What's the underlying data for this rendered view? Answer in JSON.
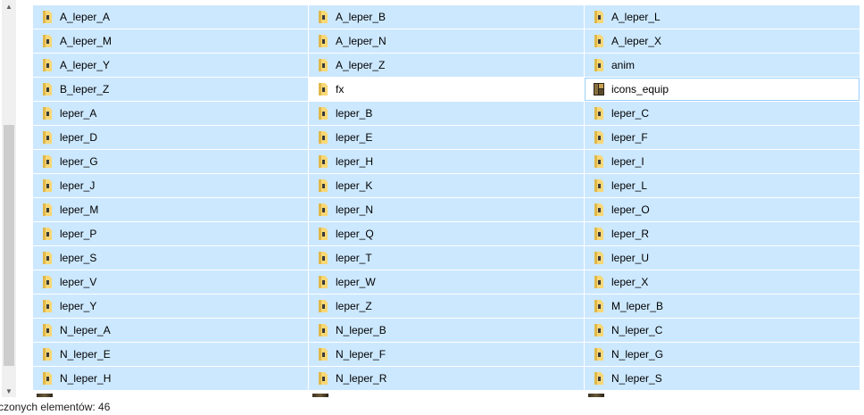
{
  "colors": {
    "selection_bg": "#cce8ff",
    "selection_border": "#99d1ff",
    "folder_yellow": "#f8d775",
    "folder_dark": "#e0b84a"
  },
  "items": [
    {
      "label": "A_leper_A",
      "icon": "folder-icon",
      "state": "selected"
    },
    {
      "label": "A_leper_B",
      "icon": "folder-icon",
      "state": "selected"
    },
    {
      "label": "A_leper_L",
      "icon": "folder-icon",
      "state": "selected"
    },
    {
      "label": "A_leper_M",
      "icon": "folder-icon",
      "state": "selected"
    },
    {
      "label": "A_leper_N",
      "icon": "folder-icon",
      "state": "selected"
    },
    {
      "label": "A_leper_X",
      "icon": "folder-icon",
      "state": "selected"
    },
    {
      "label": "A_leper_Y",
      "icon": "folder-icon",
      "state": "selected"
    },
    {
      "label": "A_leper_Z",
      "icon": "folder-icon",
      "state": "selected"
    },
    {
      "label": "anim",
      "icon": "folder-icon",
      "state": "selected"
    },
    {
      "label": "B_leper_Z",
      "icon": "folder-icon",
      "state": "selected"
    },
    {
      "label": "fx",
      "icon": "folder-icon",
      "state": "unselected"
    },
    {
      "label": "icons_equip",
      "icon": "folder-image-icon",
      "state": "focused"
    },
    {
      "label": "leper_A",
      "icon": "folder-icon",
      "state": "selected"
    },
    {
      "label": "leper_B",
      "icon": "folder-icon",
      "state": "selected"
    },
    {
      "label": "leper_C",
      "icon": "folder-icon",
      "state": "selected"
    },
    {
      "label": "leper_D",
      "icon": "folder-icon",
      "state": "selected"
    },
    {
      "label": "leper_E",
      "icon": "folder-icon",
      "state": "selected"
    },
    {
      "label": "leper_F",
      "icon": "folder-icon",
      "state": "selected"
    },
    {
      "label": "leper_G",
      "icon": "folder-icon",
      "state": "selected"
    },
    {
      "label": "leper_H",
      "icon": "folder-icon",
      "state": "selected"
    },
    {
      "label": "leper_I",
      "icon": "folder-icon",
      "state": "selected"
    },
    {
      "label": "leper_J",
      "icon": "folder-icon",
      "state": "selected"
    },
    {
      "label": "leper_K",
      "icon": "folder-icon",
      "state": "selected"
    },
    {
      "label": "leper_L",
      "icon": "folder-icon",
      "state": "selected"
    },
    {
      "label": "leper_M",
      "icon": "folder-icon",
      "state": "selected"
    },
    {
      "label": "leper_N",
      "icon": "folder-icon",
      "state": "selected"
    },
    {
      "label": "leper_O",
      "icon": "folder-icon",
      "state": "selected"
    },
    {
      "label": "leper_P",
      "icon": "folder-icon",
      "state": "selected"
    },
    {
      "label": "leper_Q",
      "icon": "folder-icon",
      "state": "selected"
    },
    {
      "label": "leper_R",
      "icon": "folder-icon",
      "state": "selected"
    },
    {
      "label": "leper_S",
      "icon": "folder-icon",
      "state": "selected"
    },
    {
      "label": "leper_T",
      "icon": "folder-icon",
      "state": "selected"
    },
    {
      "label": "leper_U",
      "icon": "folder-icon",
      "state": "selected"
    },
    {
      "label": "leper_V",
      "icon": "folder-icon",
      "state": "selected"
    },
    {
      "label": "leper_W",
      "icon": "folder-icon",
      "state": "selected"
    },
    {
      "label": "leper_X",
      "icon": "folder-icon",
      "state": "selected"
    },
    {
      "label": "leper_Y",
      "icon": "folder-icon",
      "state": "selected"
    },
    {
      "label": "leper_Z",
      "icon": "folder-icon",
      "state": "selected"
    },
    {
      "label": "M_leper_B",
      "icon": "folder-icon",
      "state": "selected"
    },
    {
      "label": "N_leper_A",
      "icon": "folder-icon",
      "state": "selected"
    },
    {
      "label": "N_leper_B",
      "icon": "folder-icon",
      "state": "selected"
    },
    {
      "label": "N_leper_C",
      "icon": "folder-icon",
      "state": "selected"
    },
    {
      "label": "N_leper_E",
      "icon": "folder-icon",
      "state": "selected"
    },
    {
      "label": "N_leper_F",
      "icon": "folder-icon",
      "state": "selected"
    },
    {
      "label": "N_leper_G",
      "icon": "folder-icon",
      "state": "selected"
    },
    {
      "label": "N_leper_H",
      "icon": "folder-icon",
      "state": "selected"
    },
    {
      "label": "N_leper_R",
      "icon": "folder-icon",
      "state": "selected"
    },
    {
      "label": "N_leper_S",
      "icon": "folder-icon",
      "state": "selected"
    }
  ],
  "status_bar": {
    "text": "czonych elementów: 46"
  },
  "scrollbar": {
    "up_glyph": "▲",
    "down_glyph": "▼"
  }
}
